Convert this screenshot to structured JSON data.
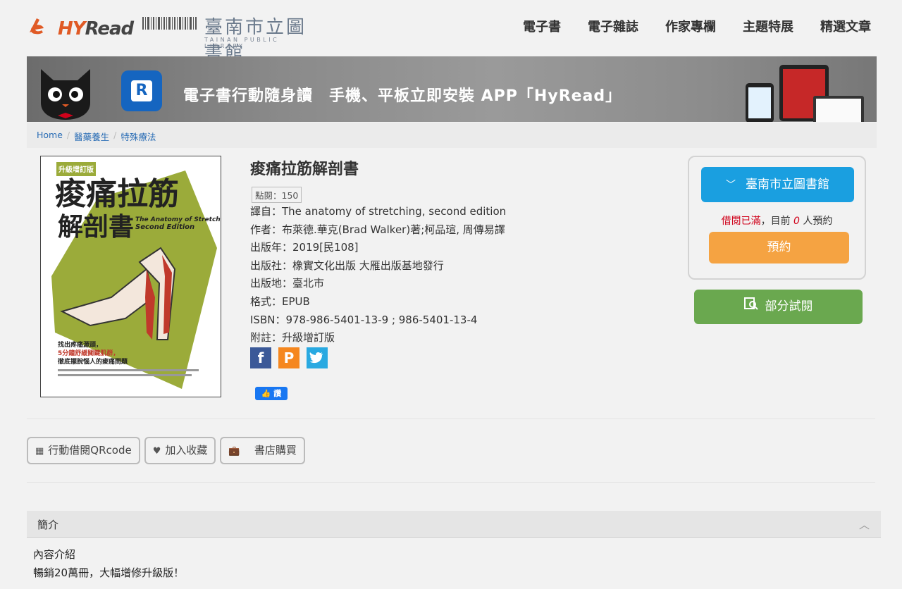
{
  "header": {
    "logo_text_hy": "HY",
    "logo_text_read": "Read",
    "library_name": "臺南市立圖書館",
    "library_sub": "TAINAN PUBLIC LIBRARY",
    "nav": [
      "電子書",
      "電子雜誌",
      "作家專欄",
      "主題特展",
      "精選文章"
    ]
  },
  "banner": {
    "app_letter": "R",
    "text": "電子書行動隨身讀　手機、平板立即安裝 APP「HyRead」"
  },
  "breadcrumb": [
    "Home",
    "醫藥養生",
    "特殊療法"
  ],
  "book": {
    "title": "痠痛拉筋解剖書",
    "views": "點閱：150",
    "meta": [
      "譯自：The anatomy of stretching, second edition",
      "作者：布萊德.華克(Brad Walker)著;柯品瑄, 周傳易譯",
      "出版年：2019[民108]",
      "出版社：橡實文化出版 大雁出版基地發行",
      "出版地：臺北市",
      "格式：EPUB",
      "ISBN：978-986-5401-13-9 ; 986-5401-13-4",
      "附註：升級增訂版"
    ],
    "like_label": "讚"
  },
  "cover": {
    "badge": "升級增訂版",
    "title_line1": "痠痛拉筋",
    "title_line2": "解剖書",
    "subtitle_line1": "The Anatomy of Stretching",
    "subtitle_line2": "Second Edition",
    "tagline1": "找出疼痛源頭，",
    "tagline2": "5分鐘舒緩關鍵肌群，",
    "tagline3": "徹底擺脫惱人的痠痛問題"
  },
  "panel": {
    "library_button": "臺南市立圖書館",
    "status_red": "借閱已滿",
    "status_mid": "，目前 ",
    "status_count": "0",
    "status_tail": " 人預約",
    "reserve_button": "預約",
    "trial_button": "部分試閱"
  },
  "actions": {
    "qrcode": "行動借閱QRcode",
    "favorite": "加入收藏",
    "store": "書店購買"
  },
  "intro": {
    "heading": "簡介",
    "line1": "內容介紹",
    "line2": "暢銷20萬冊，大幅增修升級版！"
  },
  "colors": {
    "primary_blue": "#1a9fe0",
    "reserve_orange": "#f5a342",
    "trial_green": "#6aa84f",
    "status_red": "#d0021b",
    "link_blue": "#2a6db5"
  }
}
